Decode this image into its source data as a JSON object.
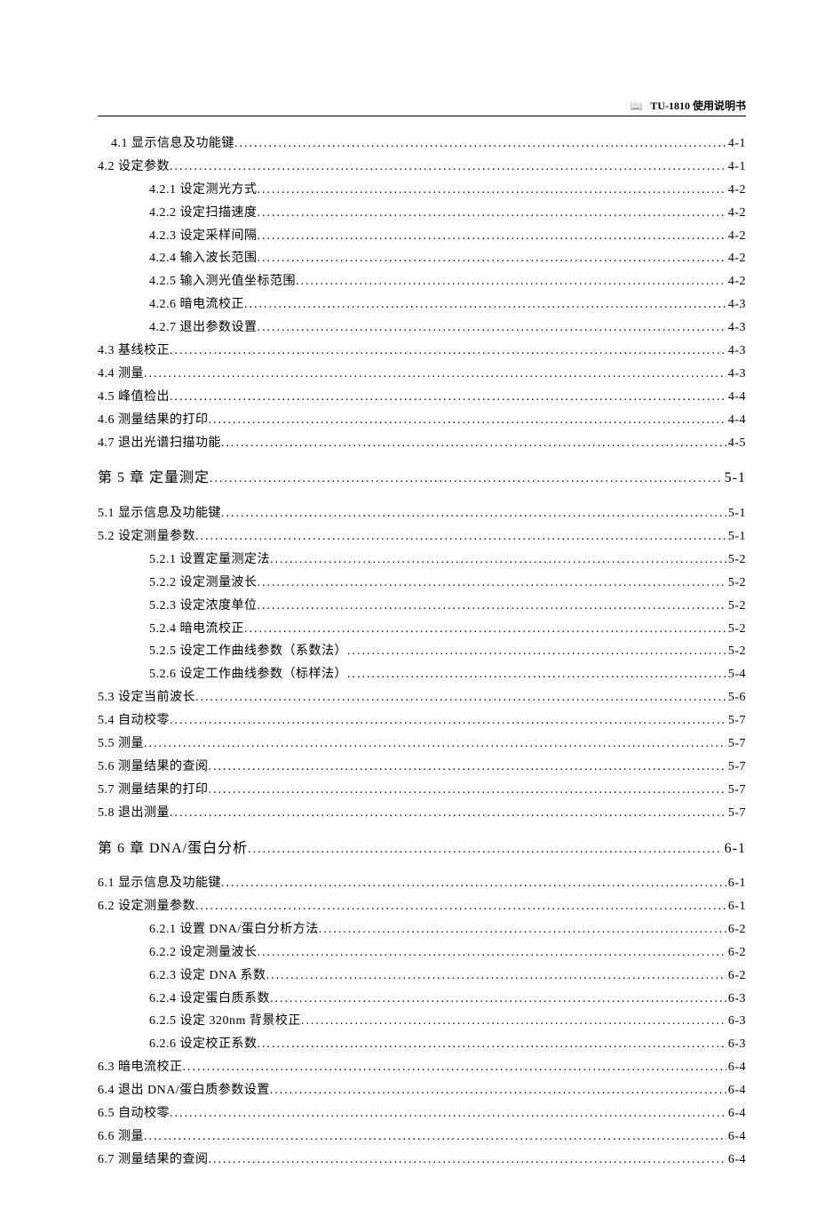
{
  "header": {
    "title": "TU-1810 使用说明书"
  },
  "entries": [
    {
      "level": 1,
      "num": "4.1",
      "title": "显示信息及功能键",
      "page": "4-1"
    },
    {
      "level": 0,
      "num": "4.2",
      "title": "设定参数",
      "page": "4-1"
    },
    {
      "level": 2,
      "num": "4.2.1",
      "title": "设定测光方式",
      "page": "4-2"
    },
    {
      "level": 2,
      "num": "4.2.2",
      "title": "设定扫描速度",
      "page": "4-2"
    },
    {
      "level": 2,
      "num": "4.2.3",
      "title": "设定采样间隔",
      "page": "4-2"
    },
    {
      "level": 2,
      "num": "4.2.4",
      "title": "输入波长范围",
      "page": "4-2"
    },
    {
      "level": 2,
      "num": "4.2.5",
      "title": "输入测光值坐标范围",
      "page": "4-2"
    },
    {
      "level": 2,
      "num": "4.2.6",
      "title": "暗电流校正",
      "page": "4-3"
    },
    {
      "level": 2,
      "num": "4.2.7",
      "title": "退出参数设置",
      "page": "4-3"
    },
    {
      "level": 0,
      "num": "4.3",
      "title": "基线校正",
      "page": "4-3"
    },
    {
      "level": 0,
      "num": "4.4",
      "title": "测量",
      "page": "4-3"
    },
    {
      "level": 0,
      "num": "4.5",
      "title": "峰值检出",
      "page": "4-4"
    },
    {
      "level": 0,
      "num": "4.6",
      "title": "测量结果的打印",
      "page": "4-4"
    },
    {
      "level": 0,
      "num": "4.7",
      "title": "退出光谱扫描功能",
      "page": "4-5"
    },
    {
      "level": "ch",
      "num": "第 5 章",
      "title": "定量测定",
      "page": "5-1"
    },
    {
      "level": 0,
      "num": "5.1",
      "title": "显示信息及功能键",
      "page": "5-1"
    },
    {
      "level": 0,
      "num": "5.2",
      "title": "设定测量参数",
      "page": "5-1"
    },
    {
      "level": 2,
      "num": "5.2.1",
      "title": "设置定量测定法",
      "page": "5-2"
    },
    {
      "level": 2,
      "num": "5.2.2",
      "title": "设定测量波长",
      "page": "5-2"
    },
    {
      "level": 2,
      "num": "5.2.3",
      "title": "设定浓度单位",
      "page": "5-2"
    },
    {
      "level": 2,
      "num": "5.2.4",
      "title": "暗电流校正",
      "page": "5-2"
    },
    {
      "level": 2,
      "num": "5.2.5",
      "title": "设定工作曲线参数（系数法）",
      "page": "5-2"
    },
    {
      "level": 2,
      "num": "5.2.6",
      "title": "设定工作曲线参数（标样法）",
      "page": "5-4"
    },
    {
      "level": 0,
      "num": "5.3",
      "title": "设定当前波长",
      "page": "5-6"
    },
    {
      "level": 0,
      "num": "5.4",
      "title": "自动校零",
      "page": "5-7"
    },
    {
      "level": 0,
      "num": "5.5",
      "title": "测量",
      "page": "5-7"
    },
    {
      "level": 0,
      "num": "5.6",
      "title": "测量结果的查阅",
      "page": "5-7"
    },
    {
      "level": 0,
      "num": "5.7",
      "title": "测量结果的打印",
      "page": "5-7"
    },
    {
      "level": 0,
      "num": "5.8",
      "title": "退出测量",
      "page": "5-7"
    },
    {
      "level": "ch",
      "num": "第 6 章",
      "title": "DNA/蛋白分析",
      "page": "6-1"
    },
    {
      "level": 0,
      "num": "6.1",
      "title": "显示信息及功能键",
      "page": "6-1"
    },
    {
      "level": 0,
      "num": "6.2",
      "title": "设定测量参数",
      "page": "6-1"
    },
    {
      "level": 2,
      "num": "6.2.1",
      "title": "设置 DNA/蛋白分析方法",
      "page": "6-2"
    },
    {
      "level": 2,
      "num": "6.2.2",
      "title": "设定测量波长",
      "page": "6-2"
    },
    {
      "level": 2,
      "num": "6.2.3",
      "title": "设定 DNA 系数",
      "page": "6-2"
    },
    {
      "level": 2,
      "num": "6.2.4",
      "title": "设定蛋白质系数",
      "page": "6-3"
    },
    {
      "level": 2,
      "num": "6.2.5",
      "title": "设定 320nm 背景校正",
      "page": "6-3"
    },
    {
      "level": 2,
      "num": "6.2.6",
      "title": "设定校正系数",
      "page": "6-3"
    },
    {
      "level": 0,
      "num": "6.3",
      "title": "暗电流校正",
      "page": "6-4"
    },
    {
      "level": 0,
      "num": "6.4",
      "title": "退出 DNA/蛋白质参数设置",
      "page": "6-4"
    },
    {
      "level": 0,
      "num": "6.5",
      "title": "自动校零",
      "page": "6-4"
    },
    {
      "level": 0,
      "num": "6.6",
      "title": "测量",
      "page": "6-4"
    },
    {
      "level": 0,
      "num": "6.7",
      "title": "测量结果的查阅",
      "page": "6-4"
    }
  ]
}
